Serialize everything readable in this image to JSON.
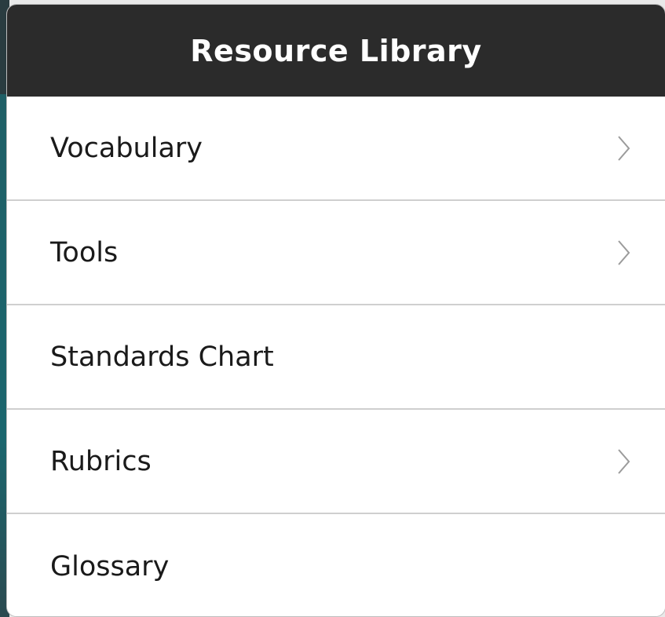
{
  "header": {
    "title": "Resource Library"
  },
  "list": {
    "items": [
      {
        "label": "Vocabulary",
        "has_chevron": true,
        "icon": "chevron-right-icon"
      },
      {
        "label": "Tools",
        "has_chevron": true,
        "icon": "chevron-right-icon"
      },
      {
        "label": "Standards Chart",
        "has_chevron": false
      },
      {
        "label": "Rubrics",
        "has_chevron": true,
        "icon": "chevron-right-icon"
      },
      {
        "label": "Glossary",
        "has_chevron": false
      }
    ]
  },
  "colors": {
    "header_background": "#2b2b2b",
    "header_text": "#ffffff",
    "row_background": "#ffffff",
    "row_text": "#1a1a1a",
    "separator": "#cfcfcf",
    "chevron": "#9b9b9b"
  }
}
